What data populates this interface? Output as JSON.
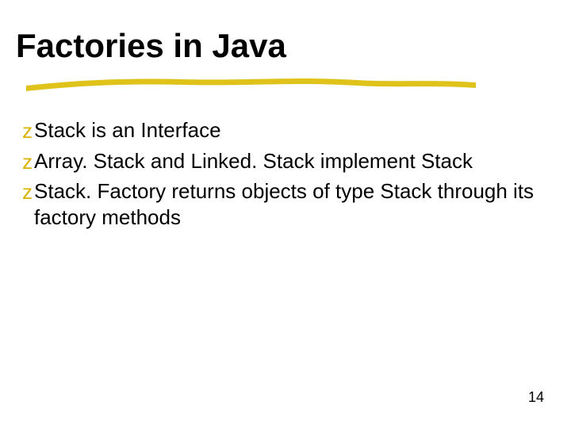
{
  "slide": {
    "title": "Factories in Java",
    "bullets": [
      {
        "icon": "z",
        "text": "Stack is an Interface"
      },
      {
        "icon": "z",
        "text": "Array. Stack and Linked. Stack implement Stack"
      },
      {
        "icon": "z",
        "text": "Stack. Factory returns objects of type Stack through its factory methods"
      }
    ],
    "page_number": "14"
  }
}
